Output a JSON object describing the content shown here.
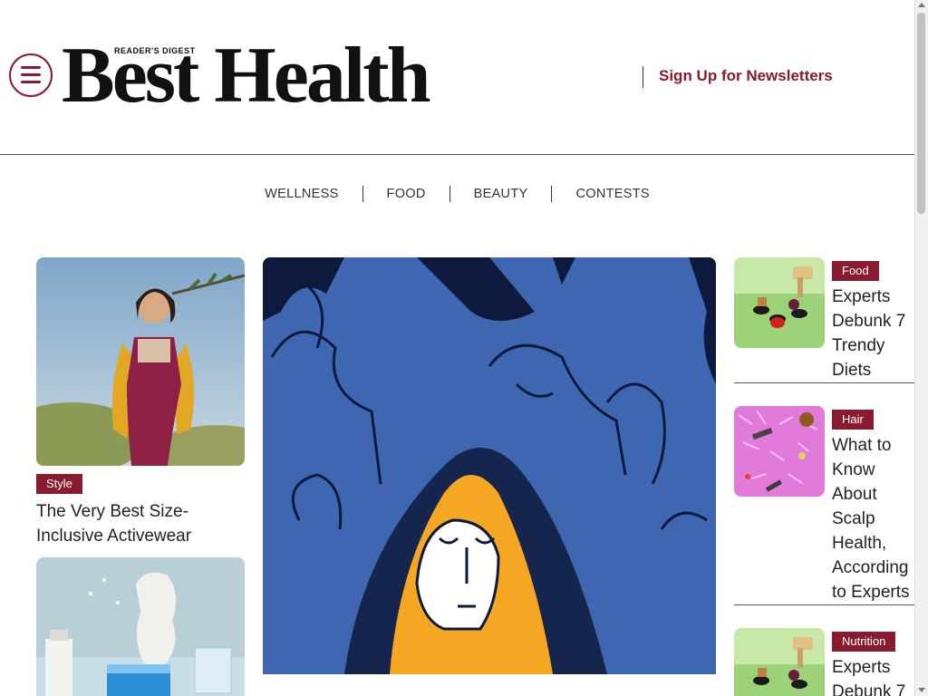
{
  "header": {
    "sub_brand": "READER'S DIGEST",
    "logo": "Best Health",
    "newsletter_label": "Sign Up for Newsletters"
  },
  "nav": {
    "items": [
      "WELLNESS",
      "FOOD",
      "BEAUTY",
      "CONTESTS"
    ]
  },
  "left_column": {
    "card1": {
      "tag": "Style",
      "title": "The Very Best Size-Inclusive Activewear"
    }
  },
  "right_column": {
    "items": [
      {
        "tag": "Food",
        "title": "Experts Debunk 7 Trendy Diets"
      },
      {
        "tag": "Hair",
        "title": "What to Know About Scalp Health, According to Experts"
      },
      {
        "tag": "Nutrition",
        "title": "Experts Debunk 7"
      }
    ]
  },
  "colors": {
    "brand": "#8a1a2e",
    "hero_blue": "#3f67b1",
    "hero_navy": "#0e1a3d",
    "hero_orange": "#f5a623"
  }
}
